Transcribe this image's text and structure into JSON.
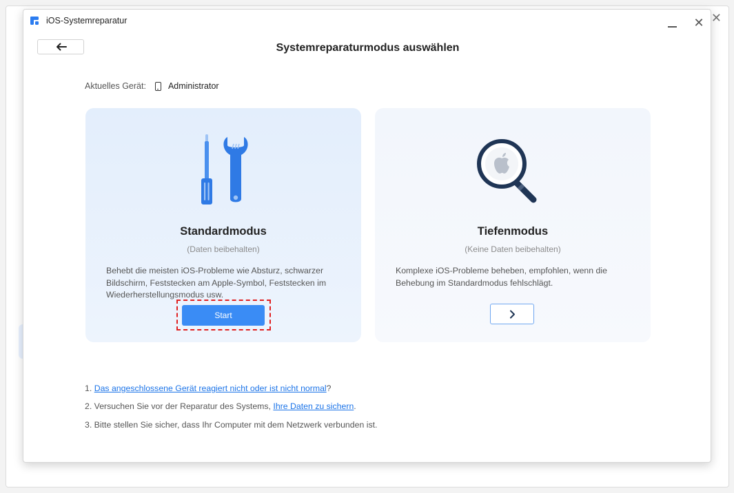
{
  "app": {
    "title": "iOS-Systemreparatur",
    "accent_color": "#3a8cf5"
  },
  "dialog": {
    "page_title": "Systemreparaturmodus auswählen",
    "device_label": "Aktuelles Gerät:",
    "device_name": "Administrator"
  },
  "modes": [
    {
      "title": "Standardmodus",
      "subtitle": "(Daten beibehalten)",
      "description": "Behebt die meisten iOS-Probleme wie Absturz, schwarzer Bildschirm, Feststecken am Apple-Symbol, Feststecken im Wiederherstellungsmodus usw.",
      "button_label": "Start",
      "icon": "tools-icon"
    },
    {
      "title": "Tiefenmodus",
      "subtitle": "(Keine Daten beibehalten)",
      "description": "Komplexe iOS-Probleme beheben, empfohlen, wenn die Behebung im Standardmodus fehlschlägt.",
      "button_icon": "chevron-right-icon",
      "icon": "magnifier-apple-icon"
    }
  ],
  "tips": {
    "tip1_prefix": "1. ",
    "tip1_link": "Das angeschlossene Gerät reagiert nicht oder ist nicht normal",
    "tip1_suffix": "?",
    "tip2_prefix": "2. Versuchen Sie vor der Reparatur des Systems, ",
    "tip2_link": "Ihre Daten zu sichern",
    "tip2_suffix": ".",
    "tip3": "3. Bitte stellen Sie sicher, dass Ihr Computer mit dem Netzwerk verbunden ist."
  },
  "window_controls": {
    "minimize_icon": "minimize-icon",
    "close_icon": "close-icon",
    "back_icon": "arrow-left-icon"
  }
}
